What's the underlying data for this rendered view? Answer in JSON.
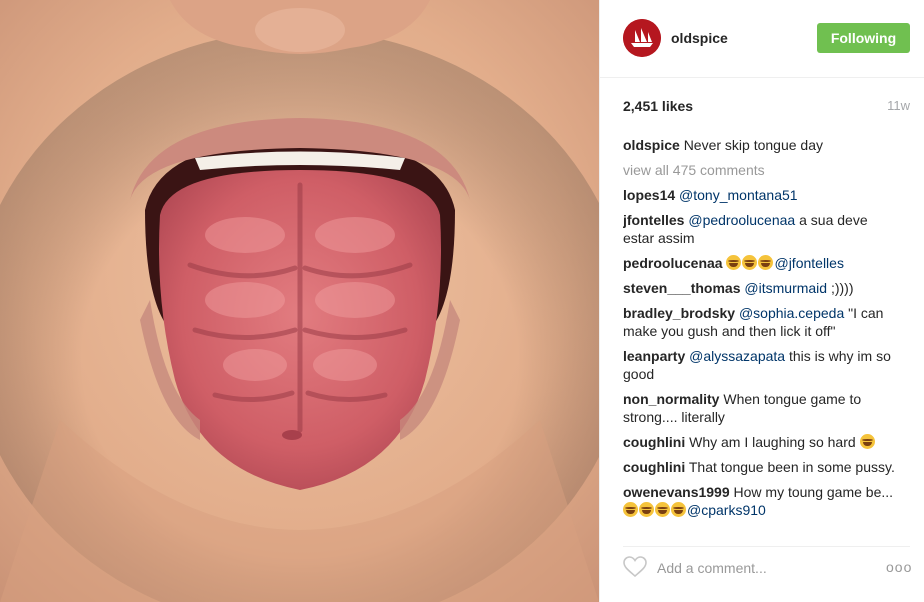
{
  "post": {
    "image_alt": "Close-up of an open mouth with a tongue shaped like six-pack abs"
  },
  "header": {
    "username": "oldspice",
    "follow_label": "Following",
    "avatar_icon": "ship-icon",
    "avatar_color": "#b5171f",
    "follow_color": "#70c050"
  },
  "stats": {
    "likes": "2,451 likes",
    "age": "11w"
  },
  "caption": {
    "user": "oldspice",
    "text": "Never skip tongue day"
  },
  "view_all": "view all 475 comments",
  "comments": [
    {
      "user": "lopes14",
      "mention": "@tony_montana51",
      "text": ""
    },
    {
      "user": "jfontelles",
      "mention": "@pedroolucenaa",
      "text": " a sua deve estar assim"
    },
    {
      "user": "pedroolucenaa",
      "emoji_before": "😂😂😂",
      "mention": "@jfontelles",
      "text": ""
    },
    {
      "user": "steven___thomas",
      "mention": "@itsmurmaid",
      "text": " ;))))"
    },
    {
      "user": "bradley_brodsky",
      "mention": "@sophia.cepeda",
      "text": " \"I can make you gush and then lick it off\""
    },
    {
      "user": "leanparty",
      "mention": "@alyssazapata",
      "text": " this is why im so good"
    },
    {
      "user": "non_normality",
      "text": "When tongue game to strong.... literally"
    },
    {
      "user": "coughlini",
      "text": "Why am I laughing so hard",
      "emoji_after": "😂"
    },
    {
      "user": "coughlini",
      "text": "That tongue been in some pussy."
    },
    {
      "user": "owenevans1999",
      "text": "How my toung game be... ",
      "emoji_mid": "😒😂😂😂",
      "mention": "@cparks910"
    }
  ],
  "footer": {
    "placeholder": "Add a comment...",
    "like_icon": "heart-icon",
    "more_icon": "more-options-icon",
    "more_glyph": "ooo"
  }
}
